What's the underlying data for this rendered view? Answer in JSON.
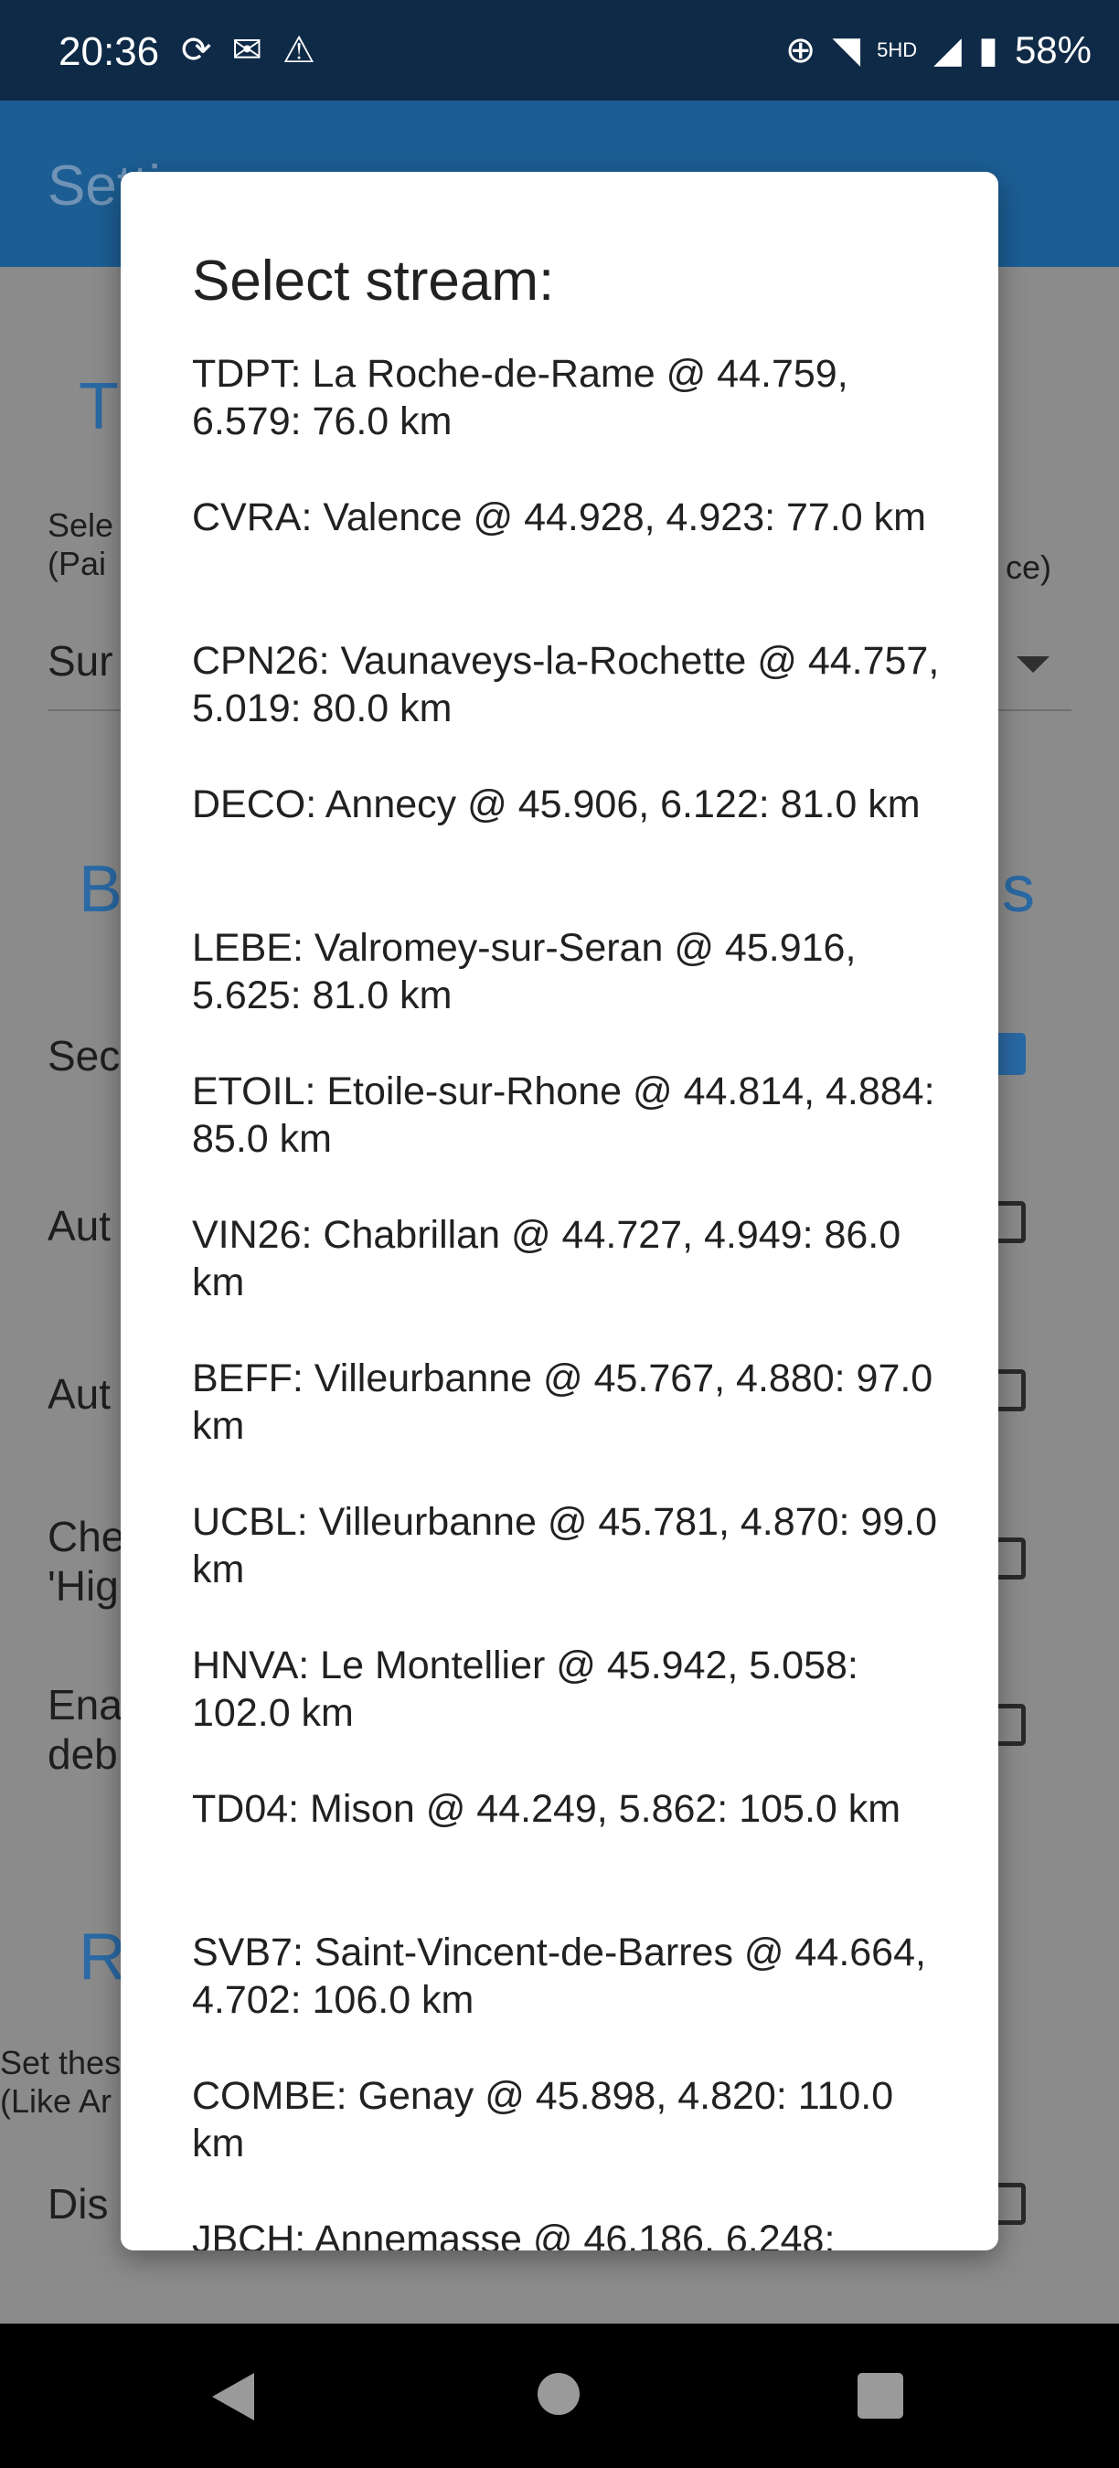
{
  "status_bar": {
    "time": "20:36",
    "icons_left": [
      "sync-icon",
      "mail-icon",
      "warning-icon"
    ],
    "icons_right": [
      "data-saver-icon",
      "wifi-icon",
      "signal-icon",
      "battery-icon"
    ],
    "network_label": "5HD",
    "battery": "58%"
  },
  "app_bar": {
    "title": "Setti"
  },
  "background": {
    "heading_1": "T",
    "select_line_1": "Sele",
    "select_line_2": "(Pai",
    "select_suffix": "ce)",
    "dropdown_value": "Sur",
    "heading_2_left": "B",
    "heading_2_right": "ls",
    "row_1": "Sec",
    "row_2": "Aut",
    "row_3": "Aut",
    "row_4_line_1": "Che",
    "row_4_line_2": "'Hig",
    "row_5_line_1": "Ena",
    "row_5_line_2": "deb",
    "heading_3": "R",
    "note_line_1": "Set thes",
    "note_line_2": "(Like Ar",
    "row_6": "Dis"
  },
  "dialog": {
    "title": "Select stream:",
    "items": [
      "TDPT: La Roche-de-Rame @ 44.759, 6.579: 76.0 km",
      "CVRA: Valence @ 44.928, 4.923: 77.0 km",
      "CPN26: Vaunaveys-la-Rochette @ 44.757, 5.019: 80.0 km",
      "DECO: Annecy @ 45.906, 6.122: 81.0 km",
      "LEBE: Valromey-sur-Seran @ 45.916, 5.625: 81.0 km",
      "ETOIL: Etoile-sur-Rhone @ 44.814, 4.884: 85.0 km",
      "VIN26: Chabrillan @ 44.727, 4.949: 86.0 km",
      "BEFF: Villeurbanne @ 45.767, 4.880: 97.0 km",
      "UCBL: Villeurbanne @ 45.781, 4.870: 99.0 km",
      "HNVA: Le Montellier @ 45.942, 5.058: 102.0 km",
      "TD04: Mison @ 44.249, 5.862: 105.0 km",
      "SVB7: Saint-Vincent-de-Barres @ 44.664, 4.702: 106.0 km",
      "COMBE: Genay @ 45.898, 4.820: 110.0 km",
      "JBCH: Annemasse @ 46.186, 6.248:"
    ]
  },
  "nav_bar": {
    "buttons": [
      "back-icon",
      "home-icon",
      "recents-icon"
    ]
  }
}
